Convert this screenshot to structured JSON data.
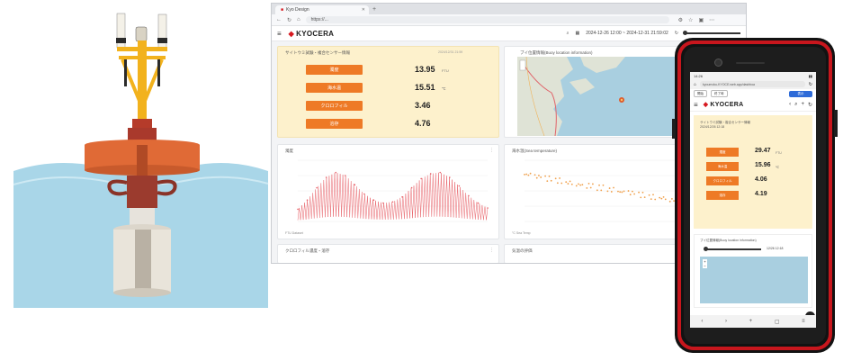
{
  "browser": {
    "tab_title": "Kyo Design",
    "url": "https://...",
    "app_logo": "KYOCERA",
    "date_range": "2024-12-26 12:00 ~ 2024-12-31 21:59:02",
    "sensor_card": {
      "title": "サイトウミ試験・複合センサー情報",
      "timestamp": "2024/12/31 21:59",
      "metrics": [
        {
          "label": "濁度",
          "value": "13.95",
          "unit": "FTU"
        },
        {
          "label": "海水温",
          "value": "15.51",
          "unit": "℃"
        },
        {
          "label": "クロロフィル",
          "value": "3.46",
          "unit": ""
        },
        {
          "label": "溶存",
          "value": "4.76",
          "unit": ""
        }
      ]
    },
    "map_card": {
      "title": "ブイ位置情報(Buoy location information)"
    },
    "chart_a": {
      "title": "濁度",
      "footer": "FTU Dataset"
    },
    "chart_b": {
      "title": "海水温(Sea temperature)",
      "footer": "°C Sea Temp"
    },
    "bottom_a": {
      "title": "クロロフィル濃度・溶存"
    },
    "bottom_b": {
      "title": "気温の評価"
    }
  },
  "phone": {
    "status_left": "14:26",
    "url": "kyoumoku-KYOCE.web.app/dashboa",
    "date_from": "開始",
    "date_to": "終了時",
    "go_label": "表示",
    "app_logo": "KYOCERA",
    "sensor_card": {
      "title": "サイトウミ試験・複合センサー情報",
      "timestamp": "2024/12/26 12:18",
      "metrics": [
        {
          "label": "濁度",
          "value": "29.47",
          "unit": "FTU"
        },
        {
          "label": "海水温",
          "value": "15.96",
          "unit": "℃"
        },
        {
          "label": "クロロフィル",
          "value": "4.06",
          "unit": ""
        },
        {
          "label": "溶存",
          "value": "4.19",
          "unit": ""
        }
      ]
    },
    "map_card": {
      "title": "ブイ位置情報(Buoy location information)",
      "slider_label": "12/26 12:18"
    }
  },
  "chart_data": [
    {
      "type": "line",
      "title": "濁度",
      "series": [
        {
          "name": "濁度",
          "color": "#e8636a",
          "values": [
            20,
            35,
            55,
            72,
            80,
            75,
            60,
            45,
            35,
            30,
            32,
            40,
            55,
            70,
            78,
            80,
            72,
            58,
            42,
            30,
            22
          ]
        }
      ],
      "ylim": [
        0,
        100
      ]
    },
    {
      "type": "scatter",
      "title": "海水温(Sea temperature)",
      "series": [
        {
          "name": "海水温",
          "color": "#f0a04b",
          "values": [
            18.6,
            18.4,
            18.2,
            18.0,
            17.8,
            17.6,
            17.5,
            17.3,
            17.1,
            16.9,
            16.8,
            16.6,
            16.4,
            16.3,
            16.1,
            16.0,
            15.9,
            15.8,
            15.7,
            15.6,
            15.5
          ]
        }
      ],
      "ylim": [
        14,
        20
      ]
    }
  ],
  "colors": {
    "accent": "#ee7a26",
    "card_bg": "#fdf1cc",
    "brand_red": "#d71920",
    "phone_red": "#c8161d"
  }
}
